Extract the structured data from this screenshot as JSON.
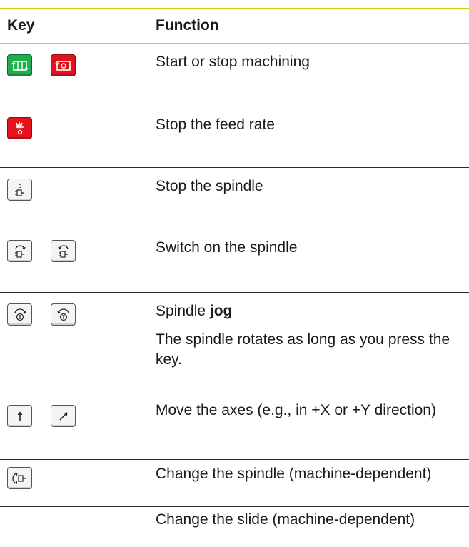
{
  "header": {
    "key": "Key",
    "function": "Function"
  },
  "rows": [
    {
      "icons": [
        "program-start-icon",
        "program-stop-icon"
      ],
      "function": "Start or stop machining"
    },
    {
      "icons": [
        "feed-stop-icon"
      ],
      "function": "Stop the feed rate"
    },
    {
      "icons": [
        "spindle-stop-icon"
      ],
      "function": "Stop the spindle"
    },
    {
      "icons": [
        "spindle-on-cw-icon",
        "spindle-on-ccw-icon"
      ],
      "function": "Switch on the spindle"
    },
    {
      "icons": [
        "spindle-jog-cw-icon",
        "spindle-jog-ccw-icon"
      ],
      "function_prefix": "Spindle ",
      "function_bold": "jog",
      "note": "The spindle rotates as long as you press the key."
    },
    {
      "icons": [
        "axis-up-arrow-icon",
        "axis-diagonal-arrow-icon"
      ],
      "function": "Move the axes (e.g., in +X or +Y direction)"
    },
    {
      "icons": [
        "change-spindle-icon"
      ],
      "function": "Change the spindle (machine-dependent)"
    },
    {
      "icons": [],
      "function": "Change the slide (machine-dependent)"
    }
  ],
  "colors": {
    "accent_rule": "#c8d400",
    "start_key": "#1fae4b",
    "stop_key": "#e3131b"
  }
}
